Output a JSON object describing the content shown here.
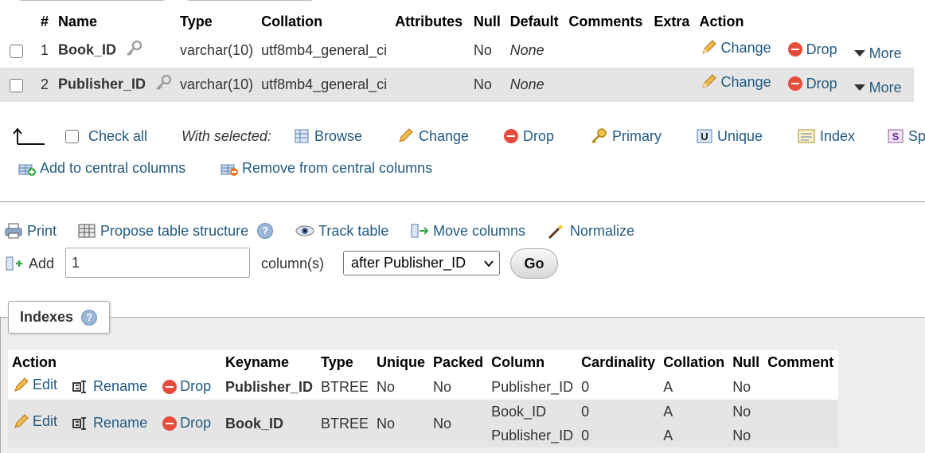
{
  "structure": {
    "headers": [
      "#",
      "Name",
      "Type",
      "Collation",
      "Attributes",
      "Null",
      "Default",
      "Comments",
      "Extra",
      "Action"
    ],
    "rows": [
      {
        "num": "1",
        "name": "Book_ID",
        "type": "varchar(10)",
        "collation": "utf8mb4_general_ci",
        "attributes": "",
        "null": "No",
        "default": "None",
        "comments": "",
        "extra": ""
      },
      {
        "num": "2",
        "name": "Publisher_ID",
        "type": "varchar(10)",
        "collation": "utf8mb4_general_ci",
        "attributes": "",
        "null": "No",
        "default": "None",
        "comments": "",
        "extra": ""
      }
    ],
    "actions": {
      "change": "Change",
      "drop": "Drop",
      "more": "More"
    }
  },
  "bulk": {
    "check_all": "Check all",
    "with_selected": "With selected:",
    "browse": "Browse",
    "change": "Change",
    "drop": "Drop",
    "primary": "Primary",
    "unique": "Unique",
    "index": "Index",
    "spatial": "Sp",
    "add_central": "Add to central columns",
    "remove_central": "Remove from central columns"
  },
  "tools": {
    "print": "Print",
    "propose": "Propose table structure",
    "track": "Track table",
    "move": "Move columns",
    "normalize": "Normalize"
  },
  "add_columns": {
    "label": "Add",
    "count": "1",
    "unit": "column(s)",
    "position": "after Publisher_ID",
    "go": "Go"
  },
  "indexes": {
    "title": "Indexes",
    "headers": [
      "Action",
      "Keyname",
      "Type",
      "Unique",
      "Packed",
      "Column",
      "Cardinality",
      "Collation",
      "Null",
      "Comment"
    ],
    "actions": {
      "edit": "Edit",
      "rename": "Rename",
      "drop": "Drop"
    },
    "rows": [
      {
        "keyname": "Publisher_ID",
        "type": "BTREE",
        "unique": "No",
        "packed": "No",
        "columns": [
          {
            "column": "Publisher_ID",
            "cardinality": "0",
            "collation": "A",
            "null": "No",
            "comment": ""
          }
        ]
      },
      {
        "keyname": "Book_ID",
        "type": "BTREE",
        "unique": "No",
        "packed": "No",
        "columns": [
          {
            "column": "Book_ID",
            "cardinality": "0",
            "collation": "A",
            "null": "No",
            "comment": ""
          },
          {
            "column": "Publisher_ID",
            "cardinality": "0",
            "collation": "A",
            "null": "No",
            "comment": ""
          }
        ]
      }
    ]
  },
  "colors": {
    "link": "#235a81",
    "row_alt": "#e5e5e5",
    "drop_red": "#e74c3c",
    "pencil": "#e8a33a"
  }
}
